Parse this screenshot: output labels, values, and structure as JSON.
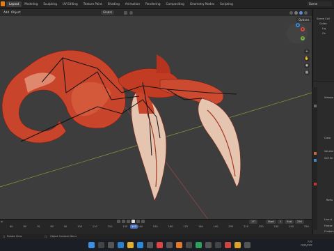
{
  "app": {
    "scene_label": "Scene"
  },
  "workspaces": [
    "Layout",
    "Modeling",
    "Sculpting",
    "UV Editing",
    "Texture Paint",
    "Shading",
    "Animation",
    "Rendering",
    "Compositing",
    "Geometry Nodes",
    "Scripting"
  ],
  "viewport_header": {
    "menu_left_1": "Add",
    "menu_left_2": "Object",
    "orientation": "Global",
    "options_label": "Options"
  },
  "timeline": {
    "ticks": [
      "60",
      "80",
      "70",
      "80",
      "90",
      "100",
      "110",
      "120",
      "130",
      "140",
      "150",
      "160",
      "170",
      "180",
      "190",
      "200",
      "210",
      "220",
      "230",
      "240",
      "250"
    ],
    "current_frame": "143",
    "frame_field": "1??",
    "start_label": "Start",
    "start_value": "1",
    "end_label": "End",
    "end_value": "250",
    "left_label": "ar"
  },
  "statusbar": {
    "left": "Rotate View",
    "mid": "Object Context Menu"
  },
  "outliner": {
    "items": [
      "Scene Coll",
      "Collec",
      "Lig",
      "Ca"
    ]
  },
  "properties": {
    "labels": [
      "Viewpo",
      "Clear",
      "Volume",
      "Self Sh",
      "Reflu",
      "Line A",
      "Freeze",
      "Custom"
    ]
  },
  "colors": {
    "accent": "#4a72c2",
    "viewport_bg": "#3d3d3d",
    "creature_main": "#c8442b",
    "creature_light": "#e8a58a",
    "claw": "#e8c9b8"
  },
  "systray": {
    "time": "7:??",
    "date": "??/??/????"
  }
}
